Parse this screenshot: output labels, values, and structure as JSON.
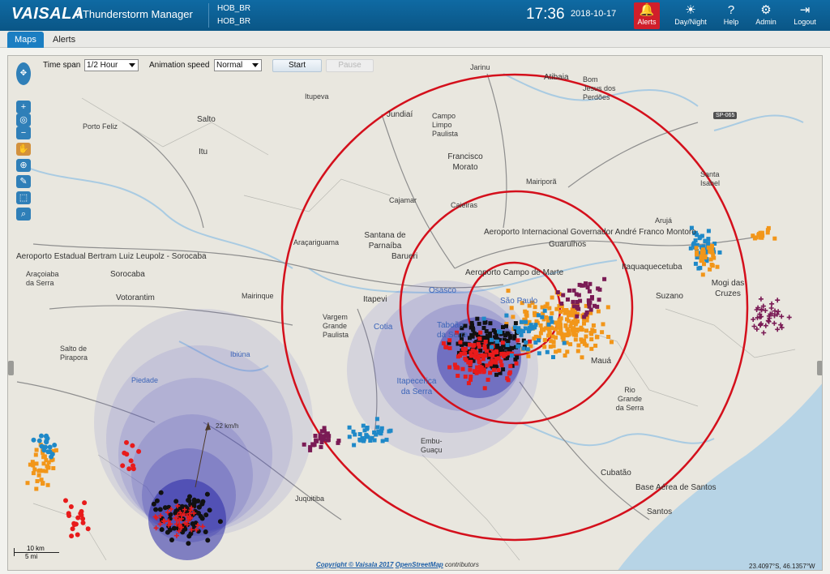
{
  "header": {
    "brand": "VAISALA",
    "app_title": "/ Thunderstorm Manager",
    "server_lines": [
      "HOB_BR",
      "HOB_BR"
    ],
    "time": "17:36",
    "date": "2018-10-17",
    "buttons": [
      {
        "label": "Alerts",
        "icon": "alerts-icon"
      },
      {
        "label": "Day/Night",
        "icon": "day-night-icon"
      },
      {
        "label": "Help",
        "icon": "help-icon"
      },
      {
        "label": "Admin",
        "icon": "admin-icon"
      },
      {
        "label": "Logout",
        "icon": "logout-icon"
      }
    ]
  },
  "tabs": [
    {
      "label": "Maps",
      "active": true
    },
    {
      "label": "Alerts",
      "active": false
    }
  ],
  "controls": {
    "time_span_label": "Time span",
    "time_span_value": "1/2 Hour",
    "animation_speed_label": "Animation speed",
    "animation_speed_value": "Normal",
    "start_label": "Start",
    "pause_label": "Pause"
  },
  "map": {
    "places": [
      "Jarinu",
      "Atibaia",
      "Bom Jesus dos Perdões",
      "Itupeva",
      "Jundiaí",
      "Campo Limpo Paulista",
      "Salto",
      "Porto Feliz",
      "Itu",
      "Francisco Morato",
      "Mairiporã",
      "Cajamar",
      "Caieiras",
      "Santa Isabel",
      "Arujá",
      "Aeroporto Internacional Governador André Franco Montoro",
      "Guarulhos",
      "Araçariguama",
      "Santana de Parnaíba",
      "Aeroporto Estadual Bertram Luiz Leupolz - Sorocaba",
      "Sorocaba",
      "Araçoiaba da Serra",
      "Barueri",
      "Aeroporto Campo de Marte",
      "Itaquaquecetuba",
      "Osasco",
      "São Paulo",
      "Mogi das Cruzes",
      "Votorantim",
      "Mairinque",
      "Itapevi",
      "Suzano",
      "Vargem Grande Paulista",
      "Cotia",
      "Taboão da Serra",
      "Salto de Pirapora",
      "Ibiúna",
      "Piedade",
      "Itapecerica da Serra",
      "Mauá",
      "Rio Grande da Serra",
      "Embu-Guaçu",
      "Juquitiba",
      "Cubatão",
      "Base Aérea de Santos",
      "Santos"
    ],
    "road_shield": "SP-065",
    "storm_speed": "22 km/h",
    "scale": {
      "km": "10 km",
      "mi": "5 mi"
    },
    "copyright_prefix": "Copyright © Vaisala 2017",
    "copyright_osm": "OpenStreetMap",
    "copyright_suffix": "contributors",
    "coordinates": "23.4097°S, 46.1357°W"
  },
  "colors": {
    "header_blue": "#0a5686",
    "alert_red": "#d01f2b",
    "ring_red": "#d4101c",
    "strike_black": "#111111",
    "strike_red": "#e81b1b",
    "strike_orange": "#f29619",
    "strike_blue": "#1f89c8",
    "strike_purple": "#7a1b55",
    "cell_shade": "#3a3ab0"
  },
  "tools": [
    "pan-icon",
    "zoom-in-icon",
    "layers-icon",
    "zoom-out-icon",
    "hand-icon",
    "zoom-box-icon",
    "measure-icon",
    "select-icon",
    "magnify-icon"
  ]
}
